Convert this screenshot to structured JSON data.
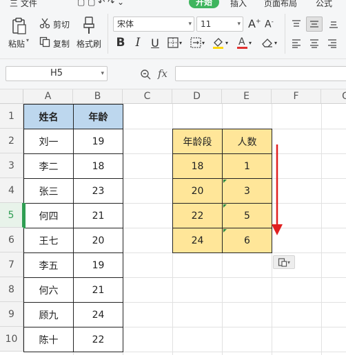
{
  "menu": {
    "items": [
      "三 文件",
      "开始",
      "插入",
      "页面布局",
      "公式"
    ],
    "active": "开始",
    "accent_color": "#3fb55e"
  },
  "ribbon": {
    "paste_label": "粘贴",
    "cut_label": "剪切",
    "copy_label": "复制",
    "format_painter_label": "格式刷",
    "font_name": "宋体",
    "font_size": "11",
    "font_color": "#e03030"
  },
  "formula_bar": {
    "name_box": "H5",
    "fx_label": "fx",
    "formula": ""
  },
  "grid": {
    "columns": [
      "A",
      "B",
      "C",
      "D",
      "E",
      "F",
      "G"
    ],
    "rows": [
      "1",
      "2",
      "3",
      "4",
      "5",
      "6",
      "7",
      "8",
      "9",
      "10"
    ],
    "selected_row": "5",
    "table1": {
      "headers": [
        "姓名",
        "年龄"
      ],
      "rows": [
        [
          "刘一",
          "19"
        ],
        [
          "李二",
          "18"
        ],
        [
          "张三",
          "23"
        ],
        [
          "何四",
          "21"
        ],
        [
          "王七",
          "20"
        ],
        [
          "李五",
          "19"
        ],
        [
          "何六",
          "21"
        ],
        [
          "顾九",
          "24"
        ],
        [
          "陈十",
          "22"
        ]
      ]
    },
    "table2": {
      "headers": [
        "年龄段",
        "人数"
      ],
      "rows": [
        [
          "18",
          "1"
        ],
        [
          "20",
          "3"
        ],
        [
          "22",
          "5"
        ],
        [
          "24",
          "6"
        ]
      ]
    },
    "header_fill": "#bdd7ee",
    "summary_fill": "#ffe699",
    "arrow_color": "#e02020"
  }
}
